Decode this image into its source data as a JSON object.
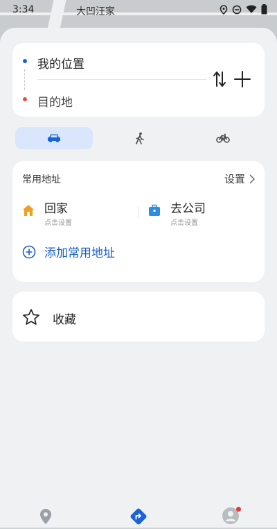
{
  "status_bar": {
    "time": "3:34",
    "map_label": "大凹汪家",
    "icons": [
      "location-icon",
      "dnd-icon",
      "wifi-icon",
      "battery-icon"
    ]
  },
  "route": {
    "from_label": "我的位置",
    "to_label": "目的地",
    "swap_icon": "swap-vertical-icon",
    "add_icon": "plus-icon"
  },
  "modes": [
    {
      "name": "car",
      "icon": "car-icon",
      "selected": true
    },
    {
      "name": "walk",
      "icon": "walk-icon",
      "selected": false
    },
    {
      "name": "bike",
      "icon": "bike-icon",
      "selected": false
    }
  ],
  "common_address": {
    "title": "常用地址",
    "settings_label": "设置",
    "home": {
      "name": "回家",
      "hint": "点击设置"
    },
    "company": {
      "name": "去公司",
      "hint": "点击设置"
    },
    "add_label": "添加常用地址"
  },
  "favorites": {
    "label": "收藏"
  },
  "bottom_nav": [
    {
      "name": "places",
      "icon": "location-pin-icon"
    },
    {
      "name": "routes",
      "icon": "route-icon",
      "selected": true
    },
    {
      "name": "profile",
      "icon": "avatar-icon",
      "badge": true
    }
  ],
  "colors": {
    "accent": "#1a63d8",
    "destination_dot": "#e0553a",
    "selected_mode_bg": "#d9e6fb",
    "sheet_bg": "#eff1f3",
    "badge": "#e53935"
  }
}
